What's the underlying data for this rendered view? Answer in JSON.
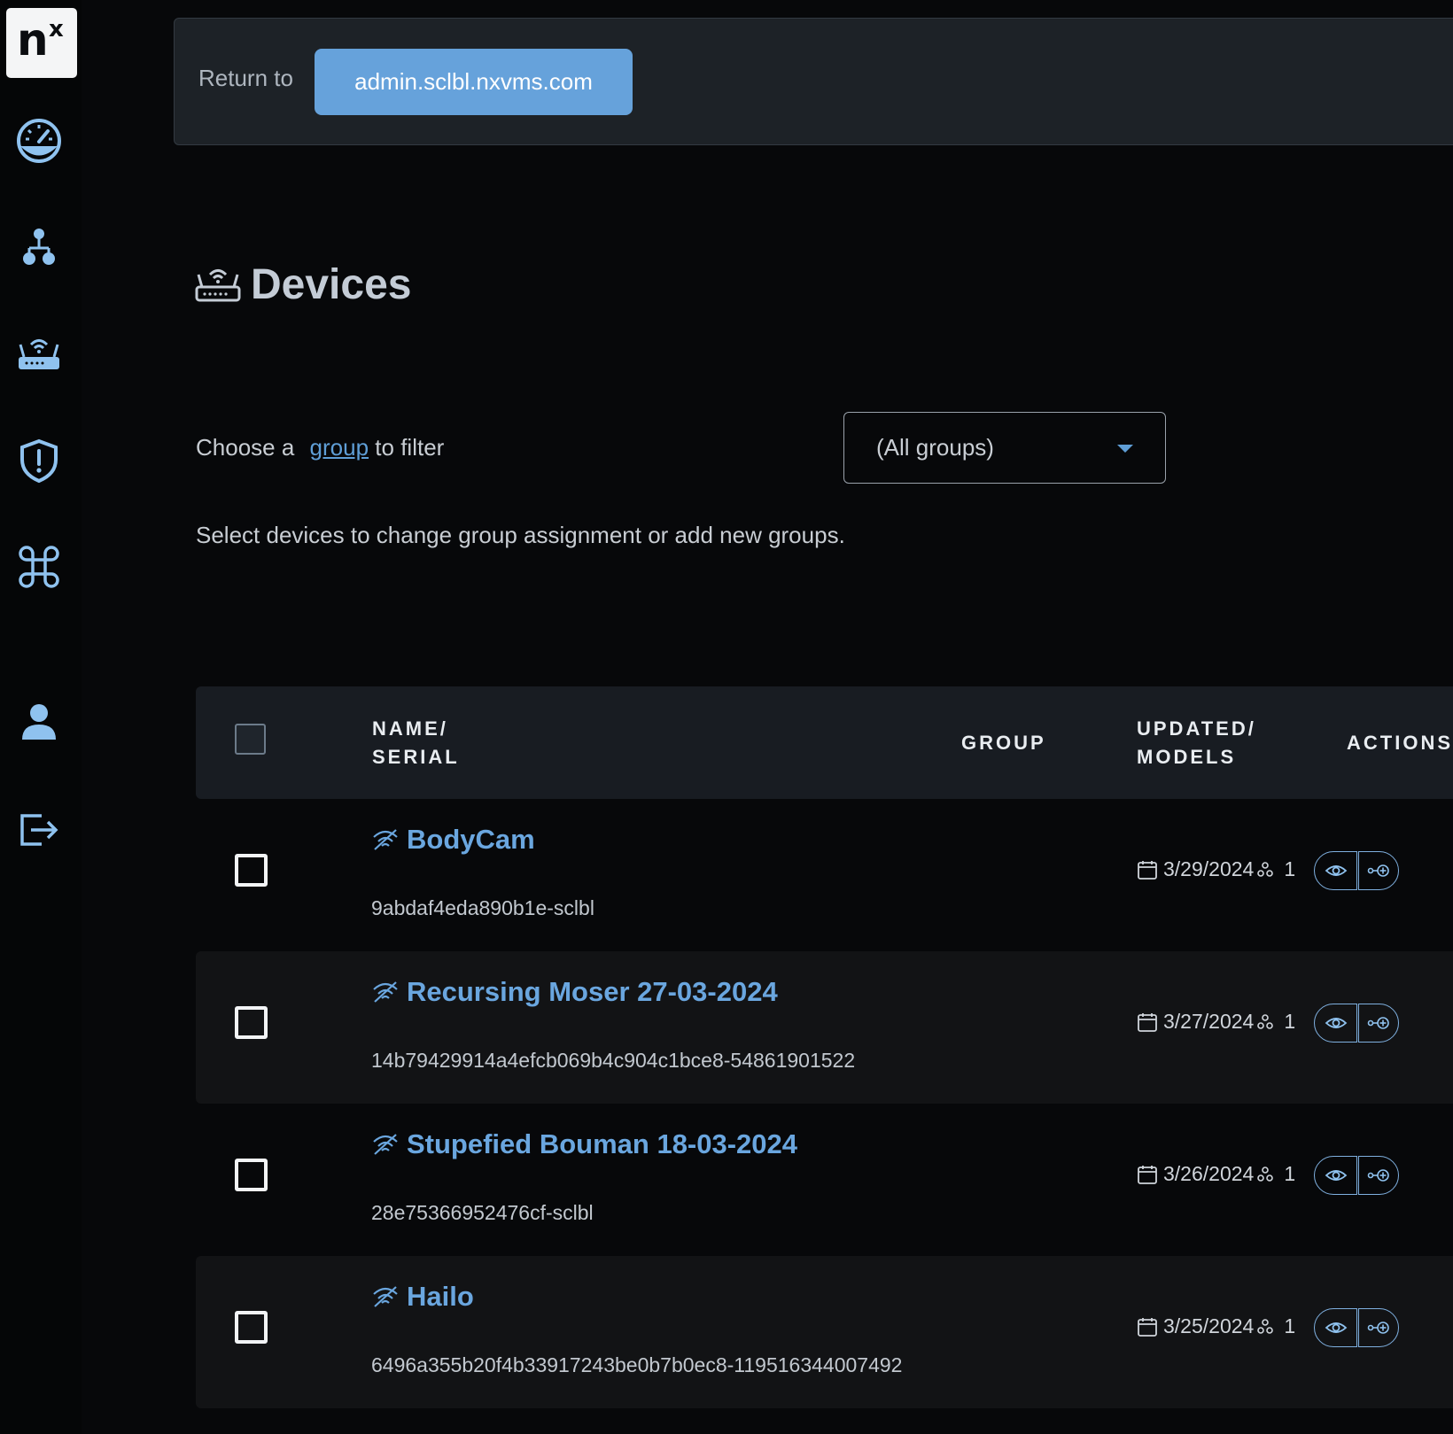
{
  "sidebar": {
    "logo_main": "n",
    "logo_sup": "x",
    "items": [
      {
        "icon": "speedometer-icon"
      },
      {
        "icon": "sitemap-icon"
      },
      {
        "icon": "router-icon"
      },
      {
        "icon": "shield-alert-icon"
      },
      {
        "icon": "command-icon"
      },
      {
        "icon": "user-icon"
      },
      {
        "icon": "logout-icon"
      }
    ]
  },
  "return_bar": {
    "label": "Return to",
    "button": "admin.sclbl.nxvms.com"
  },
  "page": {
    "title": "Devices",
    "title_icon": "router-icon"
  },
  "filter": {
    "prefix": "Choose a",
    "link": "group",
    "suffix": "to filter",
    "selected": "(All groups)"
  },
  "helper": "Select devices to change group assignment or add new groups.",
  "table": {
    "headers": {
      "name_line1": "NAME/",
      "name_line2": "SERIAL",
      "group": "GROUP",
      "updated_line1": "UPDATED/",
      "updated_line2": "MODELS",
      "actions": "ACTIONS"
    },
    "rows": [
      {
        "name": "BodyCam",
        "serial": "9abdaf4eda890b1e-sclbl",
        "updated": "3/29/2024",
        "models": "1",
        "status_icon": "offline-wifi-icon"
      },
      {
        "name": "Recursing Moser 27-03-2024",
        "serial": "14b79429914a4efcb069b4c904c1bce8-54861901522",
        "updated": "3/27/2024",
        "models": "1",
        "status_icon": "offline-wifi-icon"
      },
      {
        "name": "Stupefied Bouman 18-03-2024",
        "serial": "28e75366952476cf-sclbl",
        "updated": "3/26/2024",
        "models": "1",
        "status_icon": "offline-wifi-icon"
      },
      {
        "name": "Hailo",
        "serial": "6496a355b20f4b33917243be0b7b0ec8-119516344007492",
        "updated": "3/25/2024",
        "models": "1",
        "status_icon": "offline-wifi-icon"
      }
    ]
  },
  "colors": {
    "accent": "#66a2db",
    "background": "#07080a",
    "link": "#5f9ed6"
  }
}
